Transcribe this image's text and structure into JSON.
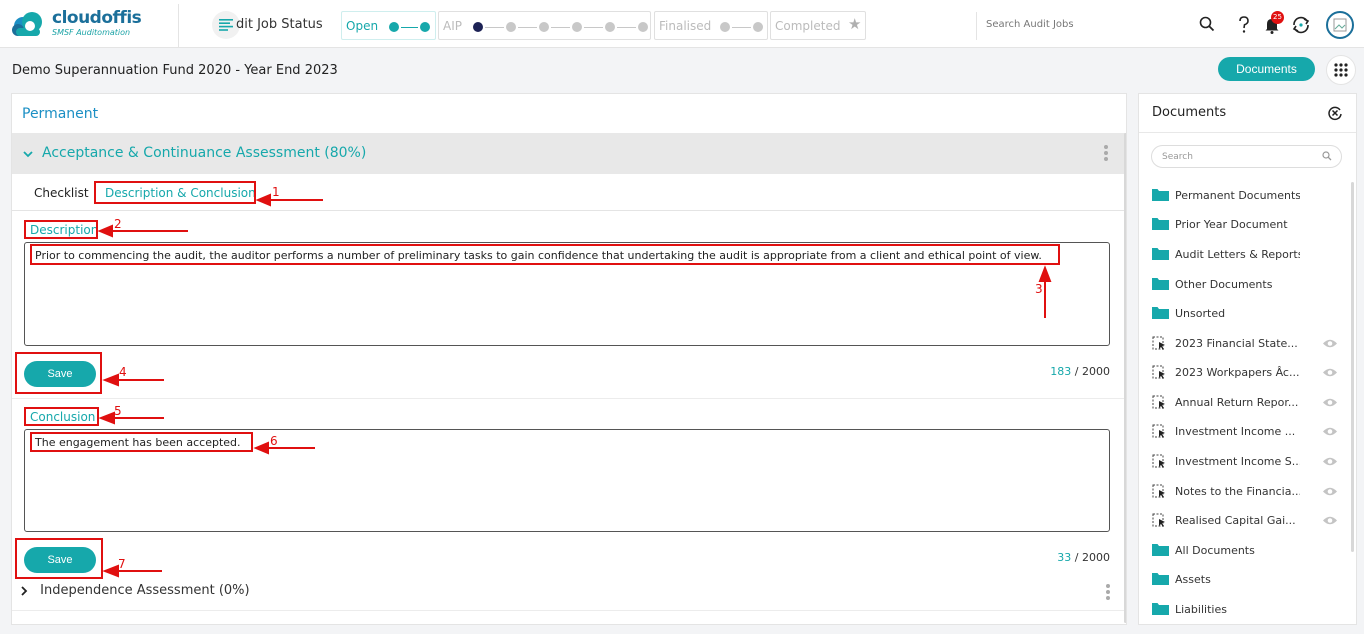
{
  "app": {
    "logo_name": "cloudoffis",
    "logo_sub": "SMSF Auditomation",
    "job_status_label": "dit Job Status"
  },
  "stages": [
    {
      "label": "Open",
      "active": true
    },
    {
      "label": "AIP",
      "active": false
    },
    {
      "label": "Finalised",
      "active": false
    },
    {
      "label": "Completed",
      "active": false
    }
  ],
  "search": {
    "placeholder": "Search Audit Jobs"
  },
  "notifications": {
    "count": "25"
  },
  "page": {
    "fund_title": "Demo Superannuation Fund 2020 - Year End 2023",
    "documents_button": "Documents"
  },
  "main": {
    "permanent_label": "Permanent",
    "section_title": "Acceptance & Continuance Assessment (80%)",
    "tabs": [
      {
        "label": "Checklist"
      },
      {
        "label": "Description & Conclusion"
      }
    ],
    "description": {
      "label": "Description",
      "text": "Prior to commencing the audit, the auditor performs a number of preliminary tasks to gain confidence that undertaking the audit is appropriate from a client and ethical point of view.",
      "save_label": "Save",
      "count": "183",
      "max": "/ 2000"
    },
    "conclusion": {
      "label": "Conclusion",
      "text": "The engagement has been accepted.",
      "save_label": "Save",
      "count": "33",
      "max": "/ 2000"
    },
    "next_section": "Independence Assessment (0%)"
  },
  "annotations": [
    "1",
    "2",
    "3",
    "4",
    "5",
    "6",
    "7"
  ],
  "documents_panel": {
    "title": "Documents",
    "search_placeholder": "Search",
    "folders": [
      {
        "label": "Permanent Documents"
      },
      {
        "label": "Prior Year Document"
      },
      {
        "label": "Audit Letters & Reports"
      },
      {
        "label": "Other Documents"
      },
      {
        "label": "Unsorted"
      }
    ],
    "files": [
      {
        "label": "2023 Financial State..."
      },
      {
        "label": "2023 Workpapers Âc..."
      },
      {
        "label": "Annual Return Repor..."
      },
      {
        "label": "Investment Income ..."
      },
      {
        "label": "Investment Income S..."
      },
      {
        "label": "Notes to the Financia..."
      },
      {
        "label": "Realised Capital Gai..."
      }
    ],
    "folders_bottom": [
      {
        "label": "All Documents"
      },
      {
        "label": "Assets"
      },
      {
        "label": "Liabilities"
      }
    ]
  },
  "colors": {
    "accent": "#16a8ab",
    "annotation": "#e01010",
    "brand": "#1b6f9a"
  }
}
